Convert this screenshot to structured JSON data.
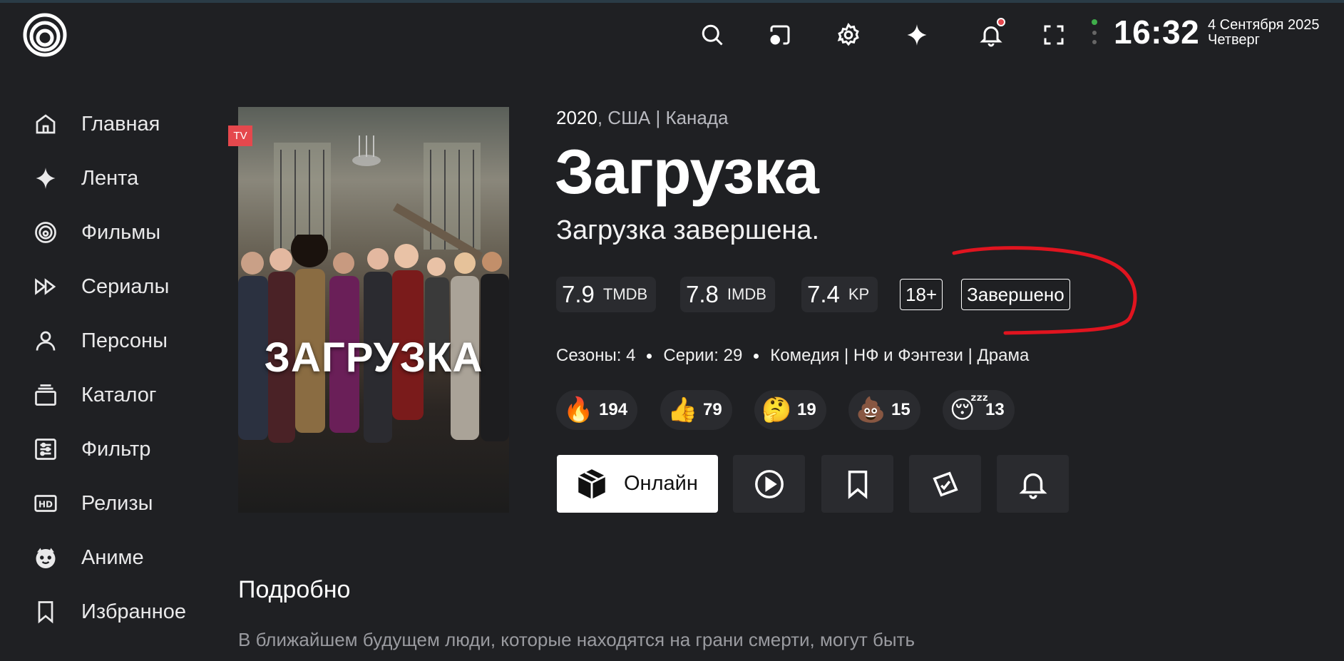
{
  "header": {
    "icons": [
      "search-icon",
      "cast-icon",
      "gear-icon",
      "sparkle-icon",
      "bell-icon",
      "fullscreen-icon"
    ],
    "time": "16:32",
    "date": "4 Сентября 2025",
    "weekday": "Четверг"
  },
  "sidebar": {
    "items": [
      {
        "label": "Главная",
        "icon": "home-icon"
      },
      {
        "label": "Лента",
        "icon": "sparkle-icon"
      },
      {
        "label": "Фильмы",
        "icon": "film-reel-icon"
      },
      {
        "label": "Сериалы",
        "icon": "fast-forward-icon"
      },
      {
        "label": "Персоны",
        "icon": "person-icon"
      },
      {
        "label": "Каталог",
        "icon": "catalog-icon"
      },
      {
        "label": "Фильтр",
        "icon": "filter-sliders-icon"
      },
      {
        "label": "Релизы",
        "icon": "hd-icon"
      },
      {
        "label": "Аниме",
        "icon": "anime-face-icon"
      },
      {
        "label": "Избранное",
        "icon": "bookmark-icon"
      }
    ]
  },
  "poster": {
    "title": "ЗАГРУЗКА",
    "badge": "TV"
  },
  "show": {
    "year": "2020",
    "countries": ", США | Канада",
    "title": "Загрузка",
    "tagline": "Загрузка завершена.",
    "ratings": [
      {
        "value": "7.9",
        "source": "TMDB"
      },
      {
        "value": "7.8",
        "source": "IMDB"
      },
      {
        "value": "7.4",
        "source": "KP"
      }
    ],
    "age": "18+",
    "status": "Завершено",
    "seasons": "Сезоны: 4",
    "episodes": "Серии: 29",
    "genres": "Комедия | НФ и Фэнтези | Драма",
    "reactions": [
      {
        "emoji": "🔥",
        "count": "194"
      },
      {
        "emoji": "👍",
        "count": "79"
      },
      {
        "emoji": "🤔",
        "count": "19"
      },
      {
        "emoji": "💩",
        "count": "15"
      },
      {
        "emoji": "😴",
        "count": "13"
      }
    ]
  },
  "actions": {
    "online_label": "Онлайн",
    "buttons": [
      "play-icon",
      "bookmark-icon",
      "edit-note-icon",
      "bell-icon"
    ]
  },
  "details": {
    "heading": "Подробно",
    "text": "В ближайшем будущем люди, которые находятся на грани смерти, могут быть"
  },
  "colors": {
    "background": "#1f2023",
    "chip": "#2a2b2f",
    "accent": "#e5484d",
    "annotation": "#e0141f"
  }
}
